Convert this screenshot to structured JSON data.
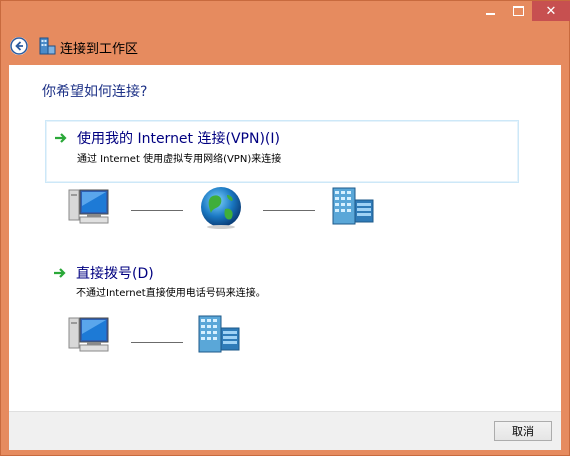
{
  "window": {
    "title": "连接到工作区",
    "controls": {
      "minimize": "minimize",
      "maximize": "maximize",
      "close": "✕"
    }
  },
  "main": {
    "question": "你希望如何连接?",
    "options": [
      {
        "title": "使用我的 Internet 连接(VPN)(I)",
        "description": "通过 Internet 使用虚拟专用网络(VPN)来连接",
        "icons": [
          "computer-icon",
          "globe-icon",
          "server-icon"
        ]
      },
      {
        "title": "直接拨号(D)",
        "description": "不通过Internet直接使用电话号码来连接。",
        "icons": [
          "computer-icon",
          "server-icon"
        ]
      }
    ]
  },
  "footer": {
    "cancel_label": "取消"
  },
  "colors": {
    "frame": "#e68b5f",
    "link_title": "#000080",
    "heading": "#1e3287",
    "close_button": "#c75050",
    "arrow_green": "#2aa838"
  }
}
